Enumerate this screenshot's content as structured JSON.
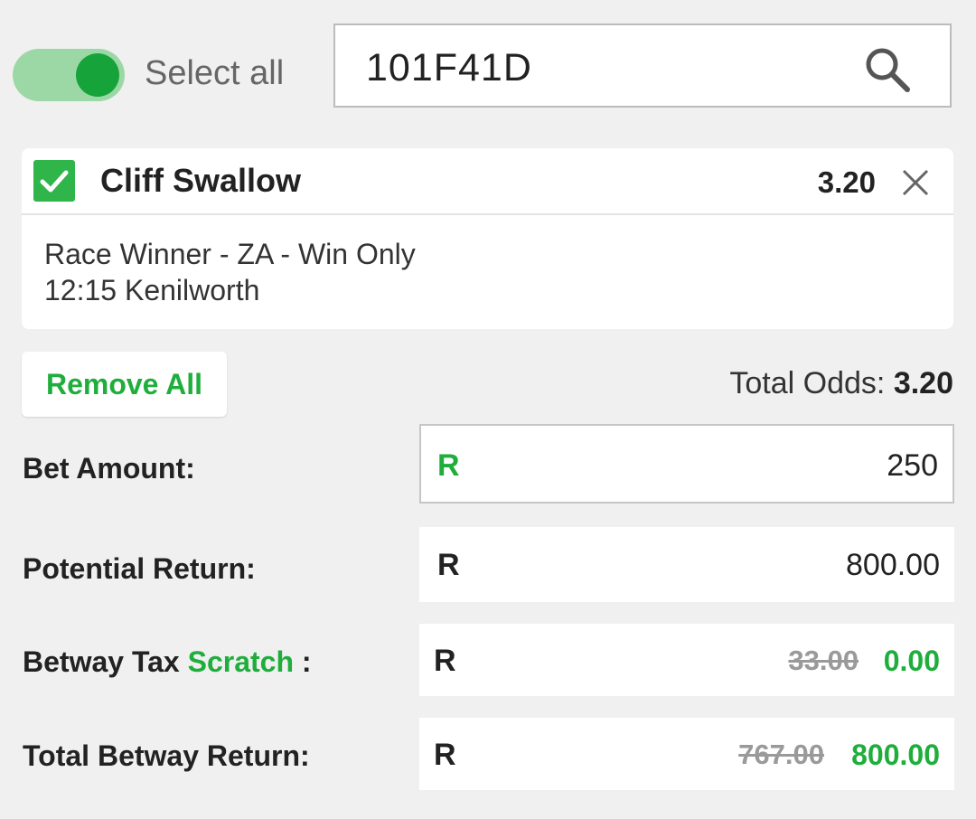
{
  "select_all": {
    "label": "Select all",
    "enabled": true
  },
  "search": {
    "value": "101F41D",
    "icon": "search-icon"
  },
  "selection": {
    "checked": true,
    "name": "Cliff Swallow",
    "odds": "3.20",
    "market": "Race Winner - ZA - Win Only",
    "event": "12:15 Kenilworth"
  },
  "actions": {
    "remove_all_label": "Remove All"
  },
  "totals": {
    "odds_label": "Total Odds:",
    "odds_value": "3.20"
  },
  "bet_amount": {
    "label": "Bet Amount:",
    "currency": "R",
    "value": "250"
  },
  "potential_return": {
    "label": "Potential Return:",
    "currency": "R",
    "value": "800.00"
  },
  "tax": {
    "label_prefix": "Betway Tax",
    "label_accent": "Scratch",
    "label_suffix": ":",
    "currency": "R",
    "old_value": "33.00",
    "new_value": "0.00"
  },
  "total_return": {
    "label": "Total Betway Return:",
    "currency": "R",
    "old_value": "767.00",
    "new_value": "800.00"
  },
  "colors": {
    "accent": "#1fae3c",
    "background": "#f0f0f0",
    "toggle_track": "#9cd8a5"
  }
}
